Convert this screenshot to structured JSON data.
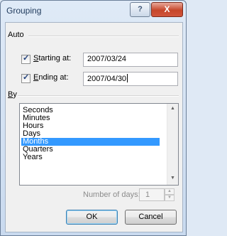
{
  "window": {
    "title": "Grouping",
    "help_icon": "question-mark-icon",
    "close_icon": "close-x-icon",
    "help_glyph": "?",
    "close_glyph": "X"
  },
  "auto": {
    "label": "Auto",
    "starting": {
      "checked": true,
      "prefix": "S",
      "rest": "tarting at:",
      "value": "2007/03/24"
    },
    "ending": {
      "checked": true,
      "prefix": "E",
      "rest": "nding at:",
      "value": "2007/04/30"
    }
  },
  "by": {
    "label_prefix": "B",
    "label_rest": "y",
    "items": [
      "Seconds",
      "Minutes",
      "Hours",
      "Days",
      "Months",
      "Quarters",
      "Years"
    ],
    "selected": "Months"
  },
  "days": {
    "label": "Number of days:",
    "value": "1",
    "enabled": false
  },
  "buttons": {
    "ok": "OK",
    "cancel": "Cancel"
  },
  "colors": {
    "selection": "#3399ff",
    "close_button": "#c6462a"
  }
}
